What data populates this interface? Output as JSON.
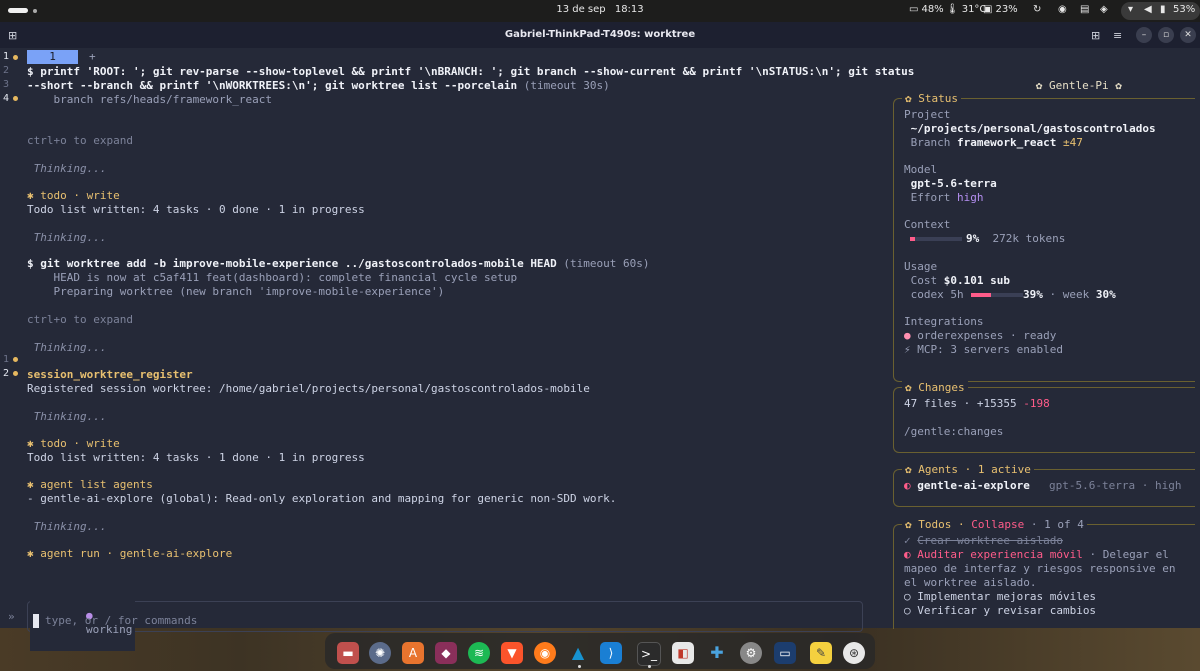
{
  "topbar": {
    "date": "13 de sep",
    "time": "18:13",
    "battery_pct": "48%",
    "temp": "31°C",
    "disk_pct": "23%",
    "battery_pct2": "53%"
  },
  "window": {
    "title": "Gabriel-ThinkPad-T490s: worktree"
  },
  "terminal": {
    "tab_label": "1",
    "tab_add": "+",
    "line_numbers": [
      "1",
      "2",
      "3",
      "4",
      "1",
      "2"
    ],
    "cmd1_line1": "$ printf 'ROOT: '; git rev-parse --show-toplevel && printf '\\nBRANCH: '; git branch --show-current && printf '\\nSTATUS:\\n'; git status",
    "cmd1_line2": "--short --branch && printf '\\nWORKTREES:\\n'; git worktree list --porcelain",
    "cmd1_timeout": " (timeout 30s)",
    "cmd1_out": "    branch refs/heads/framework_react",
    "expand1": "ctrl+o to expand",
    "thinking1": " Thinking...",
    "todo1_icon": "✱",
    "todo1_title": " todo · write",
    "todo1_result": "Todo list written: 4 tasks · 0 done · 1 in progress",
    "thinking2": " Thinking...",
    "cmd2": "$ git worktree add -b improve-mobile-experience ../gastoscontrolados-mobile HEAD",
    "cmd2_timeout": " (timeout 60s)",
    "cmd2_out1": "    HEAD is now at c5af411 feat(dashboard): complete financial cycle setup",
    "cmd2_out2": "    Preparing worktree (new branch 'improve-mobile-experience')",
    "expand2": "ctrl+o to expand",
    "thinking3": " Thinking...",
    "session_title": "session_worktree_register",
    "session_result": "Registered session worktree: /home/gabriel/projects/personal/gastoscontrolados-mobile",
    "thinking4": " Thinking...",
    "todo2_icon": "✱",
    "todo2_title": " todo · write",
    "todo2_result": "Todo list written: 4 tasks · 1 done · 1 in progress",
    "agents_icon": "✱",
    "agents_title": " agent list agents",
    "agents_result": "- gentle-ai-explore (global): Read-only exploration and mapping for generic non-SDD work.",
    "thinking5": " Thinking...",
    "run_icon": "✱",
    "run_title": " agent run · gentle-ai-explore",
    "working_label": "working",
    "input_placeholder": "type, or / for commands",
    "bottom_marker": "»"
  },
  "sidebar": {
    "header": "✿ Gentle-Pi ✿",
    "status": {
      "title": "✿ Status",
      "project_label": "Project",
      "project_value": " ~/projects/personal/gastoscontrolados",
      "branch_label": " Branch ",
      "branch_value": "framework_react",
      "branch_delta": " ±47",
      "model_label": "Model",
      "model_value": " gpt-5.6-terra",
      "effort_label": " Effort ",
      "effort_value": "high",
      "context_label": "Context",
      "context_pct": "9%",
      "context_tokens": "272k tokens",
      "context_fill": 0.09,
      "usage_label": "Usage",
      "cost_label": " Cost ",
      "cost_value": "$0.101 sub",
      "codex_label": " codex 5h ",
      "codex_pct": "39%",
      "codex_fill": 0.39,
      "week_label": " · week ",
      "week_pct": "30%",
      "integrations_label": "Integrations",
      "int1": " orderexpenses · ready",
      "int2": " MCP: 3 servers enabled"
    },
    "changes": {
      "title": "✿ Changes",
      "files": "47 files · +15355 ",
      "deleted": "-198",
      "command": "/gentle:changes"
    },
    "agents": {
      "title": "✿ Agents · 1 active",
      "agent_name": " gentle-ai-explore",
      "agent_model": "gpt-5.6-terra · high"
    },
    "todos": {
      "title_prefix": "✿ Todos · ",
      "collapse": "Collapse",
      "count": " · 1 of 4",
      "item1": "Crear worktree aislado",
      "item2_title": "Auditar experiencia móvil",
      "item2_desc_a": " · Delegar el",
      "item2_desc_b": "mapeo de interfaz y riesgos responsive en",
      "item2_desc_c": "el worktree aislado.",
      "item3": "Implementar mejoras móviles",
      "item4": "Verificar y revisar cambios"
    }
  },
  "dock": {
    "apps": [
      "files-icon",
      "chromium-icon",
      "app-store-icon",
      "pdf-icon",
      "spotify-icon",
      "brave-icon",
      "firefox-icon",
      "arch-icon",
      "vscode-icon",
      "terminal-icon",
      "toggle-icon",
      "extensions-icon",
      "settings-icon",
      "remote-desktop-icon",
      "notes-icon",
      "ubuntu-icon"
    ]
  },
  "colors": {
    "accent": "#e8c070",
    "pink": "#ff5c8a",
    "tab": "#7aa2f7",
    "bg": "#252938"
  }
}
